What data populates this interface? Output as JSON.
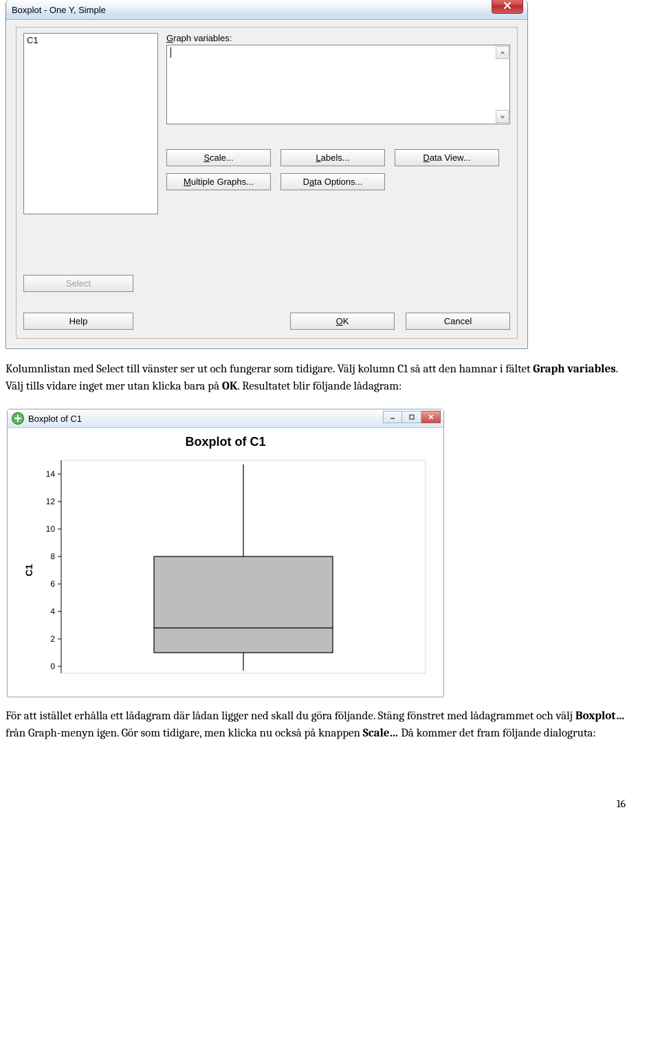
{
  "dialog1": {
    "title": "Boxplot - One Y, Simple",
    "list": {
      "items": [
        "C1"
      ]
    },
    "graph_variables_label": "Graph variables:",
    "buttons": {
      "scale": "Scale...",
      "scale_u": "S",
      "labels": "Labels...",
      "labels_u": "L",
      "dataview": "Data View...",
      "dataview_u": "D",
      "multgraphs": "Multiple Graphs...",
      "multgraphs_u": "M",
      "dataoptions": "Data Options...",
      "dataoptions_u": "a",
      "select": "Select",
      "help": "Help",
      "ok": "OK",
      "ok_u": "O",
      "cancel": "Cancel"
    }
  },
  "para1": {
    "t1": "Kolumnlistan med Select till vänster ser ut och fungerar som tidigare. Välj kolumn C1 så att den hamnar i fältet ",
    "b1": "Graph variables",
    "t2": ". Välj tills vidare inget mer utan klicka bara på ",
    "b2": "OK",
    "t3": ". Resultatet blir följande lådagram:"
  },
  "chartwin": {
    "title": "Boxplot of C1",
    "chart_title": "Boxplot of C1",
    "ylabel": "C1"
  },
  "chart_data": {
    "type": "boxplot",
    "title": "Boxplot of C1",
    "ylabel": "C1",
    "ylim": [
      -0.5,
      15
    ],
    "yticks": [
      0,
      2,
      4,
      6,
      8,
      10,
      12,
      14
    ],
    "series": [
      {
        "name": "C1",
        "min": -0.3,
        "q1": 1.0,
        "median": 2.8,
        "q3": 8.0,
        "max": 14.7
      }
    ]
  },
  "para2": {
    "t1": "För att istället erhålla ett lådagram där lådan ligger ned skall du göra följande. Stäng fönstret med lådagrammet och välj ",
    "b1": "Boxplot…",
    "t2": " från Graph-menyn igen. Gör som tidigare, men klicka nu också på knappen ",
    "b2": "Scale…",
    "t3": " Då kommer det fram följande dialogruta:"
  },
  "pagenum": "16"
}
